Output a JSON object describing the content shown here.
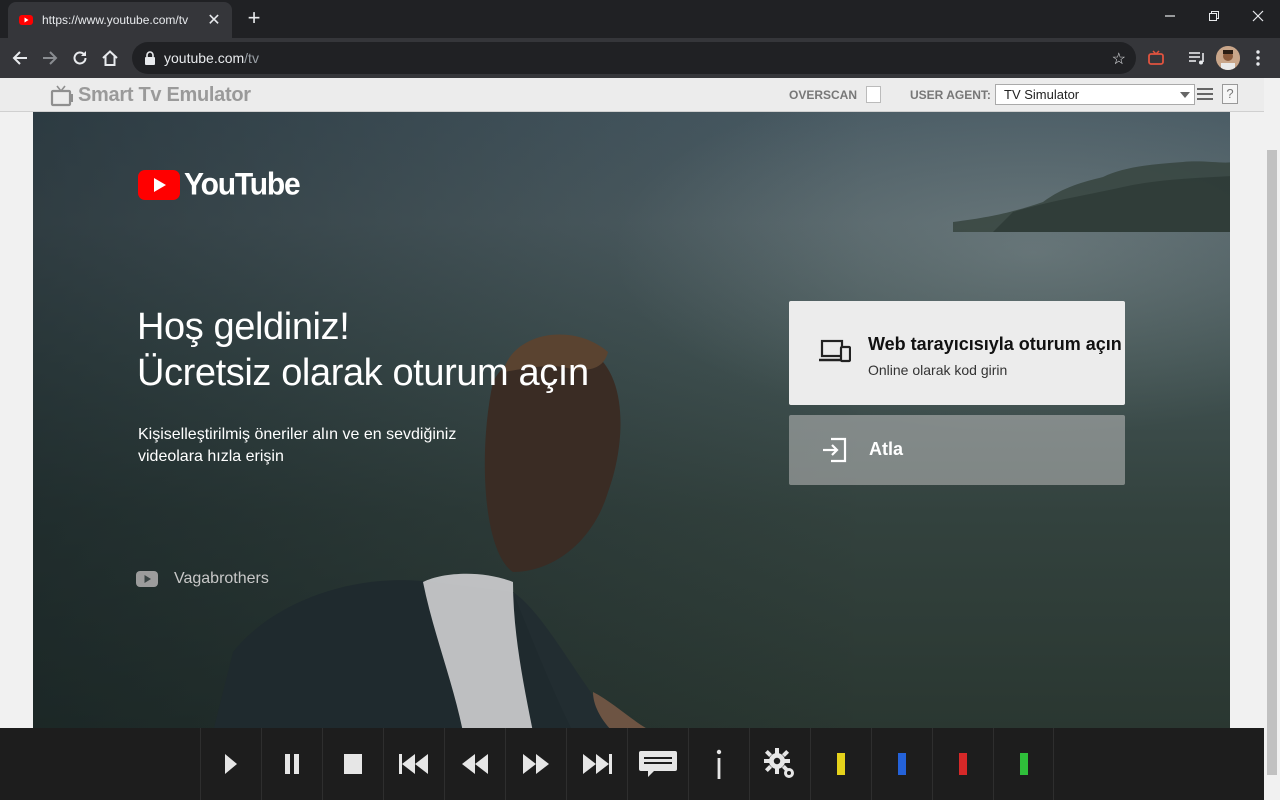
{
  "browser": {
    "tab_title": "https://www.youtube.com/tv",
    "url_host": "youtube.com",
    "url_path": "/tv"
  },
  "emulator": {
    "logo_text": "Smart Tv Emulator",
    "overscan_label": "OVERSCAN",
    "overscan_checked": false,
    "user_agent_label": "USER AGENT:",
    "user_agent_value": "TV Simulator",
    "help_label": "?"
  },
  "tv": {
    "brand": "YouTube",
    "welcome_line1": "Hoş geldiniz!",
    "welcome_line2": "Ücretsiz olarak oturum açın",
    "subtext": "Kişiselleştirilmiş öneriler alın ve en sevdiğiniz videolara hızla erişin",
    "credit": "Vagabrothers",
    "signin_title": "Web tarayıcısıyla oturum açın",
    "signin_subtitle": "Online olarak kod girin",
    "skip_label": "Atla"
  },
  "remote": {
    "buttons": [
      "play",
      "pause",
      "stop",
      "skip-previous",
      "rewind",
      "fast-forward",
      "skip-next",
      "subtitles",
      "info",
      "settings",
      "yellow",
      "blue",
      "red",
      "green"
    ],
    "colors": {
      "yellow": "#e5d21b",
      "blue": "#2462d9",
      "red": "#d62828",
      "green": "#2fbf3a"
    }
  },
  "colors": {
    "brand_red": "#ff0000",
    "chrome_dark": "#202124",
    "chrome_toolbar": "#35363a"
  }
}
